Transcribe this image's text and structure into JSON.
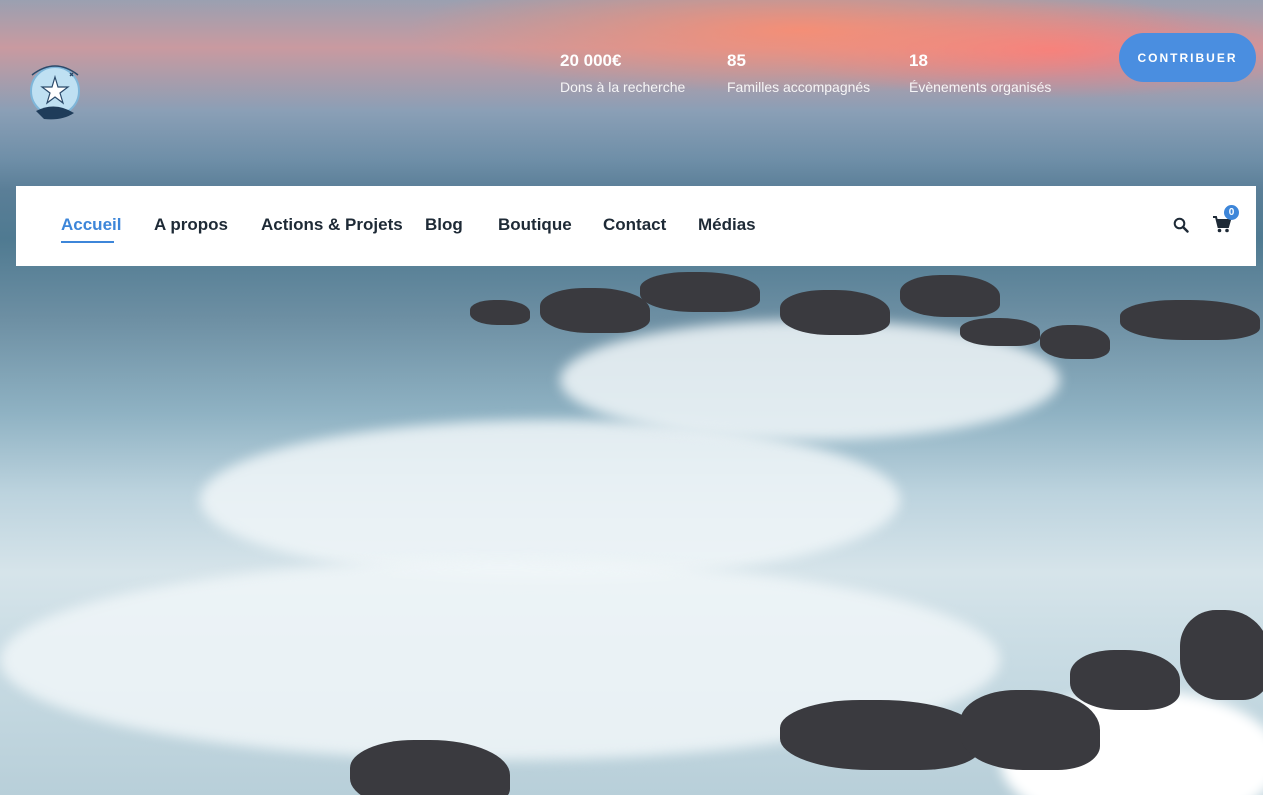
{
  "brand": {
    "logo_alt": "Des étoiles dans la mer",
    "logo_text": "DES ÉTOILES DANS LA MER"
  },
  "stats": [
    {
      "value": "20 000€",
      "label": "Dons à la recherche"
    },
    {
      "value": "85",
      "label": "Familles accompagnés"
    },
    {
      "value": "18",
      "label": "Évènements organisés"
    }
  ],
  "cta": {
    "label": "CONTRIBUER"
  },
  "nav": {
    "items": [
      {
        "label": "Accueil",
        "active": true
      },
      {
        "label": "A propos"
      },
      {
        "label": "Actions & Projets"
      },
      {
        "label": "Blog"
      },
      {
        "label": "Boutique"
      },
      {
        "label": "Contact"
      },
      {
        "label": "Médias"
      }
    ],
    "cart_count": "0"
  },
  "colors": {
    "accent": "#3d86d9",
    "cta": "#4a8ee0",
    "nav_text": "#1e2a36"
  },
  "icons": {
    "search": "search-icon",
    "cart": "cart-icon"
  }
}
